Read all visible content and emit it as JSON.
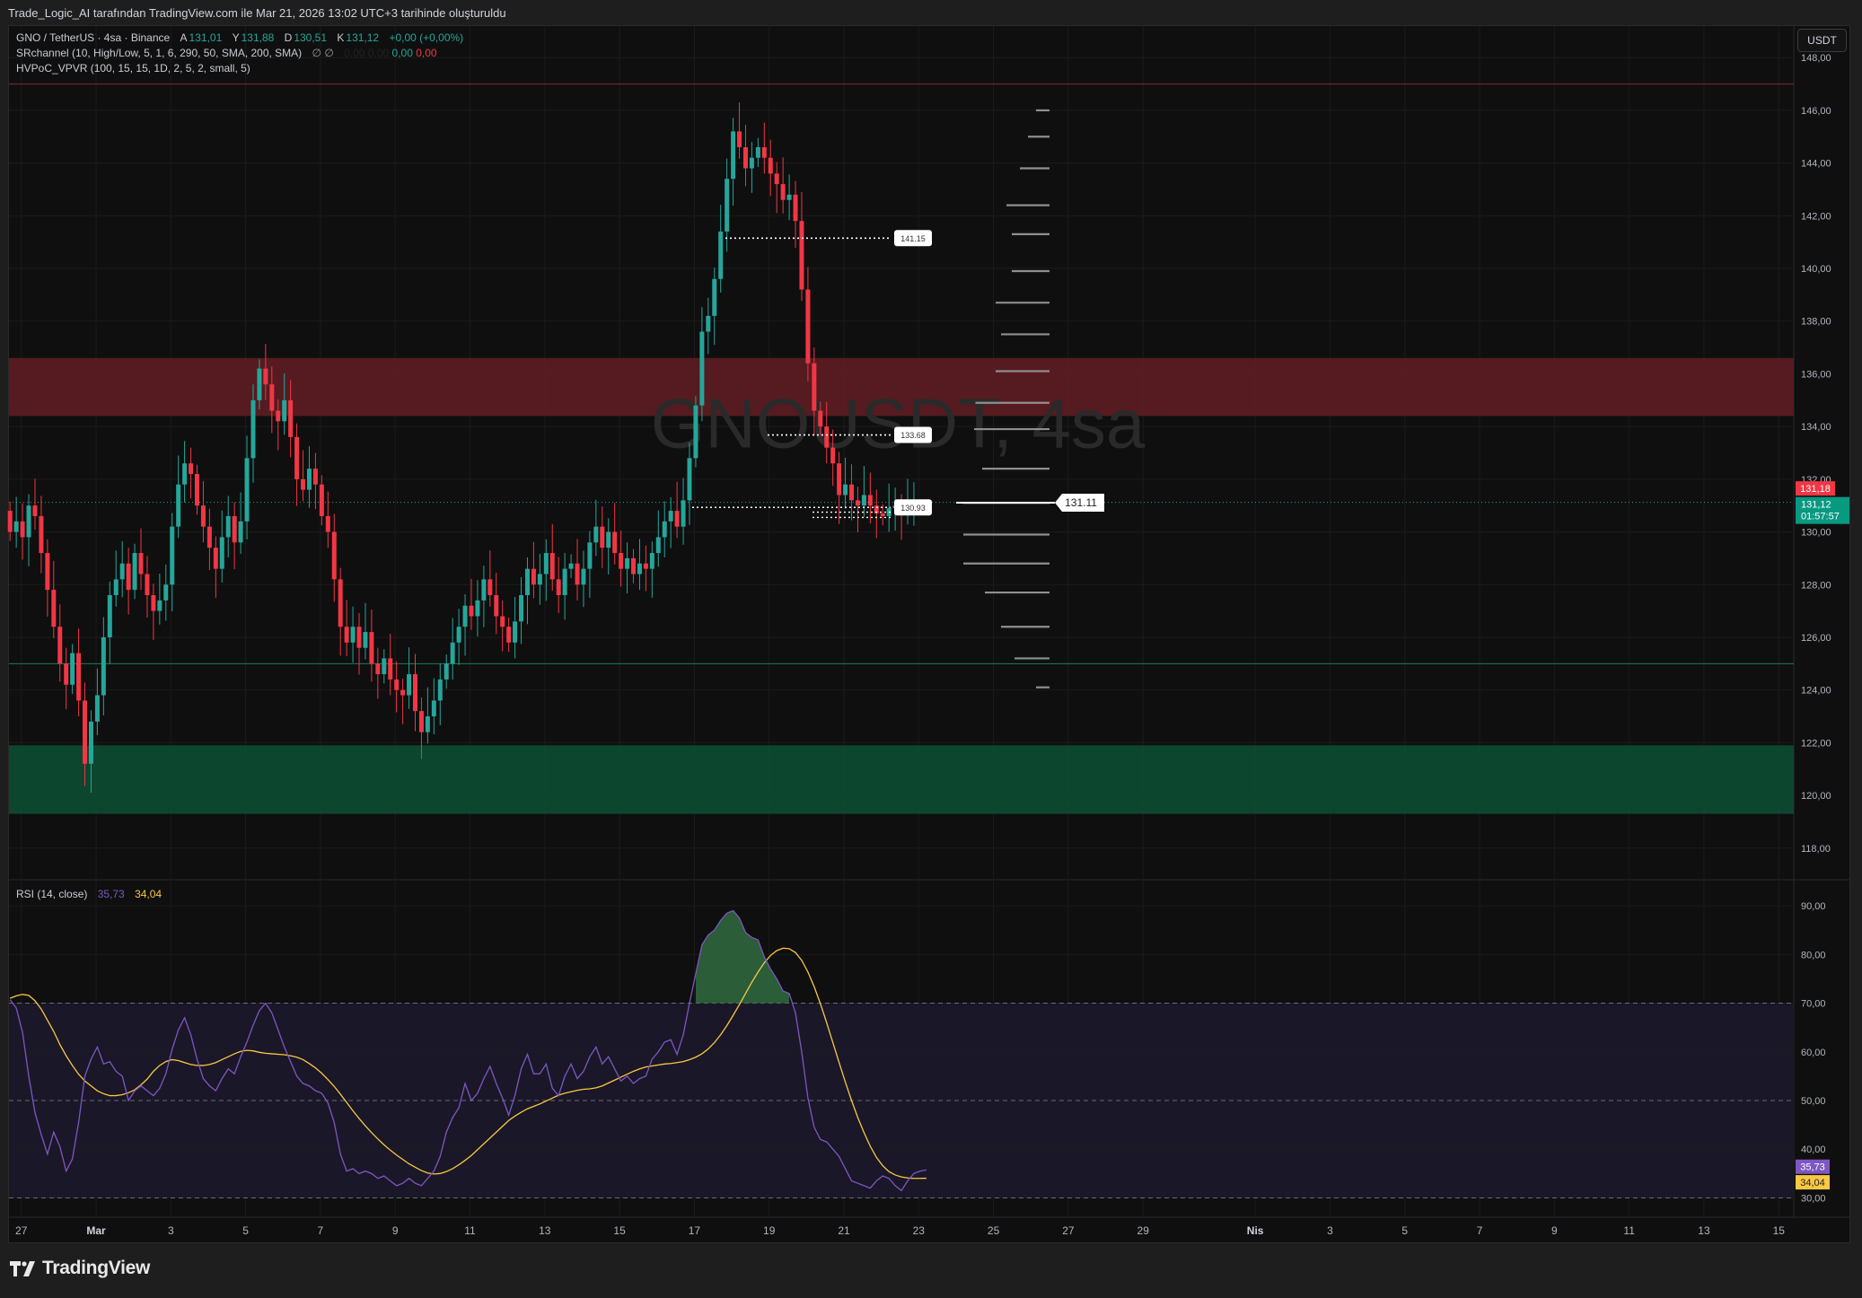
{
  "header": {
    "attribution": "Trade_Logic_AI tarafından TradingView.com ile Mar 21, 2026 13:02 UTC+3 tarihinde oluşturuldu"
  },
  "legend": {
    "symbol": "GNO / TetherUS · 4sa · Binance",
    "o_label": "A",
    "o_value": "131,01",
    "h_label": "Y",
    "h_value": "131,88",
    "l_label": "D",
    "l_value": "130,51",
    "c_label": "K",
    "c_value": "131,12",
    "change": "+0,00 (+0,00%)",
    "indicator1": "SRchannel (10, High/Low, 5, 1, 6, 290, 50, SMA, 200, SMA)",
    "indicator1_sym": "∅ ∅",
    "indicator1_v1": "0,00",
    "indicator1_v2": "0,00",
    "indicator1_v3": "0,00",
    "indicator1_v4": "0,00",
    "indicator2": "HVPoC_VPVR (100, 15, 15, 1D, 2, 5, 2, small, 5)",
    "rsi_label": "RSI (14, close)",
    "rsi_value": "35,73",
    "rsi_ma_value": "34,04"
  },
  "watermark": "GNOUSDT, 4sa",
  "currency_button": "USDT",
  "brand": "TradingView",
  "price_badges": {
    "last_red": "131,18",
    "last_green": "131,12",
    "countdown": "01:57:57",
    "rsi_badge": "35,73",
    "rsi_ma_badge": "34,04"
  },
  "colors": {
    "up": "#26a69a",
    "down": "#f23645",
    "rsi": "#7e57c2",
    "rsi_ma": "#f9c842",
    "resistance_zone": "#5a1c22",
    "support_zone": "#0e4a31"
  },
  "chart_data": [
    {
      "type": "candlestick",
      "title": "GNO / TetherUS · 4sa · Binance",
      "ylim": [
        116.8,
        149.2
      ],
      "y_ticks": [
        "148,00",
        "146,00",
        "144,00",
        "142,00",
        "140,00",
        "138,00",
        "136,00",
        "134,00",
        "132,00",
        "130,00",
        "128,00",
        "126,00",
        "124,00",
        "122,00",
        "120,00",
        "118,00"
      ],
      "y_tick_values": [
        148,
        146,
        144,
        142,
        140,
        138,
        136,
        134,
        132,
        130,
        128,
        126,
        124,
        122,
        120,
        118
      ],
      "x_ticks": [
        "27",
        "Mar",
        "3",
        "5",
        "7",
        "9",
        "11",
        "13",
        "15",
        "17",
        "19",
        "21",
        "23",
        "25",
        "27",
        "29",
        "Nis",
        "3",
        "5",
        "7",
        "9",
        "11",
        "13",
        "15"
      ],
      "x_tick_days": [
        -2,
        0,
        2,
        4,
        6,
        8,
        10,
        12,
        14,
        16,
        18,
        20,
        22,
        24,
        26,
        28,
        31,
        33,
        35,
        37,
        39,
        41,
        43,
        45
      ],
      "candle_period_days": 0.1667,
      "first_candle_day": -2.3,
      "closes": [
        130.0,
        130.4,
        129.8,
        131.0,
        130.6,
        129.2,
        127.8,
        126.4,
        125.0,
        124.2,
        125.4,
        123.6,
        121.2,
        122.8,
        123.8,
        126.0,
        127.6,
        128.2,
        128.8,
        127.8,
        129.2,
        128.4,
        127.6,
        127.0,
        127.4,
        128.0,
        130.2,
        131.8,
        132.6,
        132.2,
        131.0,
        130.2,
        129.4,
        128.6,
        129.8,
        130.6,
        129.6,
        130.4,
        132.8,
        135.0,
        136.2,
        135.6,
        134.6,
        134.2,
        135.0,
        133.6,
        132.0,
        131.6,
        132.4,
        131.8,
        130.6,
        130.0,
        128.2,
        126.4,
        125.8,
        126.4,
        125.6,
        126.2,
        125.0,
        124.6,
        125.2,
        124.4,
        124.0,
        123.8,
        124.6,
        123.2,
        122.4,
        123.0,
        123.6,
        124.4,
        125.0,
        125.8,
        126.4,
        127.2,
        126.8,
        127.4,
        128.2,
        127.6,
        126.8,
        126.4,
        125.8,
        126.6,
        127.6,
        128.6,
        128.0,
        128.4,
        129.2,
        128.2,
        127.6,
        128.6,
        128.8,
        128.0,
        128.6,
        129.6,
        130.2,
        129.4,
        130.0,
        129.2,
        128.6,
        129.0,
        128.4,
        128.8,
        128.6,
        129.2,
        129.8,
        130.4,
        130.8,
        130.2,
        131.2,
        132.8,
        134.8,
        137.6,
        138.2,
        139.6,
        141.4,
        143.4,
        145.2,
        144.6,
        143.8,
        144.2,
        144.6,
        144.2,
        143.6,
        143.2,
        142.6,
        142.8,
        141.8,
        139.2,
        136.4,
        134.6,
        134.0,
        133.2,
        132.6,
        131.4,
        131.8,
        131.2,
        131.0,
        131.4,
        131.0,
        130.7,
        130.6,
        130.9,
        131.0,
        130.8,
        131.0,
        131.12
      ],
      "support_zone": [
        119.3,
        121.9
      ],
      "resistance_zone": [
        134.4,
        136.6
      ],
      "horizontal_levels": [
        147.0,
        125.0
      ],
      "dotted_levels": [
        {
          "value": 141.15,
          "label": "141.15"
        },
        {
          "value": 133.68,
          "label": "133.68"
        },
        {
          "value": 130.93,
          "label": "130.93"
        }
      ],
      "poc": {
        "value": 131.11,
        "label": "131.11"
      },
      "last_price": 131.12
    },
    {
      "type": "line",
      "title": "RSI (14, close)",
      "ylim": [
        27.5,
        95
      ],
      "y_ticks": [
        "90,00",
        "80,00",
        "70,00",
        "60,00",
        "50,00",
        "40,00",
        "30,00"
      ],
      "y_tick_values": [
        90,
        80,
        70,
        60,
        50,
        40,
        30
      ],
      "bands": [
        70,
        50,
        30
      ],
      "series": [
        {
          "name": "RSI",
          "values": [
            70.7,
            69.0,
            64.0,
            55.0,
            47.5,
            43.0,
            39.0,
            43.5,
            40.5,
            35.5,
            38.0,
            45.5,
            55.0,
            58.5,
            61.0,
            57.5,
            58.0,
            56.0,
            55.0,
            50.0,
            52.0,
            53.0,
            52.0,
            51.0,
            52.5,
            55.5,
            60.5,
            64.5,
            67.0,
            63.5,
            58.5,
            54.5,
            53.0,
            52.0,
            54.5,
            56.5,
            55.5,
            59.0,
            62.0,
            65.5,
            68.5,
            70.0,
            68.0,
            64.5,
            61.0,
            58.0,
            55.0,
            53.5,
            53.0,
            52.0,
            51.5,
            49.5,
            45.5,
            39.0,
            35.5,
            36.0,
            35.0,
            35.5,
            35.0,
            34.0,
            34.5,
            33.5,
            32.5,
            33.0,
            34.0,
            33.0,
            32.5,
            34.0,
            35.5,
            38.5,
            43.5,
            46.5,
            48.5,
            53.5,
            50.0,
            51.5,
            54.5,
            57.0,
            53.5,
            50.5,
            47.0,
            51.0,
            56.5,
            59.5,
            55.5,
            55.5,
            57.5,
            52.5,
            51.0,
            55.0,
            57.5,
            54.5,
            56.0,
            59.0,
            61.0,
            57.5,
            59.0,
            56.5,
            54.0,
            55.0,
            53.5,
            54.5,
            55.0,
            58.5,
            60.0,
            62.0,
            62.5,
            59.5,
            63.5,
            70.0,
            76.0,
            82.0,
            84.0,
            85.0,
            87.0,
            88.5,
            89.0,
            87.5,
            84.5,
            83.5,
            83.0,
            79.5,
            77.0,
            75.0,
            72.5,
            72.0,
            68.0,
            60.0,
            50.5,
            44.5,
            42.0,
            41.5,
            40.0,
            38.5,
            36.0,
            33.5,
            33.0,
            32.5,
            32.0,
            33.5,
            34.5,
            34.0,
            32.5,
            31.5,
            33.5,
            35.0,
            35.5,
            35.73
          ]
        },
        {
          "name": "RSI-based MA",
          "values": [
            71.0,
            71.5,
            71.8,
            71.6,
            70.5,
            68.8,
            66.5,
            64.2,
            61.5,
            59.2,
            57.2,
            55.4,
            54.0,
            53.0,
            52.0,
            51.4,
            51.0,
            51.0,
            51.2,
            51.6,
            52.2,
            53.2,
            54.4,
            56.0,
            57.2,
            58.0,
            58.4,
            58.2,
            57.8,
            57.4,
            57.2,
            57.2,
            57.4,
            57.8,
            58.4,
            59.0,
            59.6,
            60.1,
            60.3,
            60.2,
            59.9,
            59.7,
            59.6,
            59.5,
            59.4,
            59.2,
            58.9,
            58.4,
            57.6,
            56.7,
            55.6,
            54.3,
            52.9,
            51.3,
            49.6,
            47.9,
            46.3,
            44.8,
            43.4,
            42.1,
            40.9,
            39.8,
            38.8,
            37.9,
            37.0,
            36.3,
            35.6,
            35.1,
            34.9,
            35.0,
            35.4,
            36.0,
            36.8,
            37.7,
            38.7,
            39.9,
            41.1,
            42.3,
            43.5,
            44.7,
            45.9,
            46.8,
            47.6,
            48.3,
            48.8,
            49.3,
            49.9,
            50.5,
            51.1,
            51.5,
            51.8,
            52.1,
            52.3,
            52.4,
            52.6,
            53.0,
            53.6,
            54.2,
            54.8,
            55.4,
            56.0,
            56.5,
            56.9,
            57.1,
            57.3,
            57.5,
            57.6,
            57.8,
            58.0,
            58.4,
            58.9,
            59.6,
            60.6,
            61.9,
            63.5,
            65.4,
            67.5,
            69.7,
            72.0,
            74.3,
            76.4,
            78.3,
            79.8,
            80.8,
            81.3,
            81.2,
            80.4,
            78.8,
            76.4,
            73.4,
            69.9,
            66.0,
            61.9,
            57.8,
            53.8,
            50.0,
            46.5,
            43.4,
            40.6,
            38.3,
            36.6,
            35.4,
            34.7,
            34.3,
            34.1,
            34.0,
            34.0,
            34.04
          ]
        }
      ]
    }
  ]
}
